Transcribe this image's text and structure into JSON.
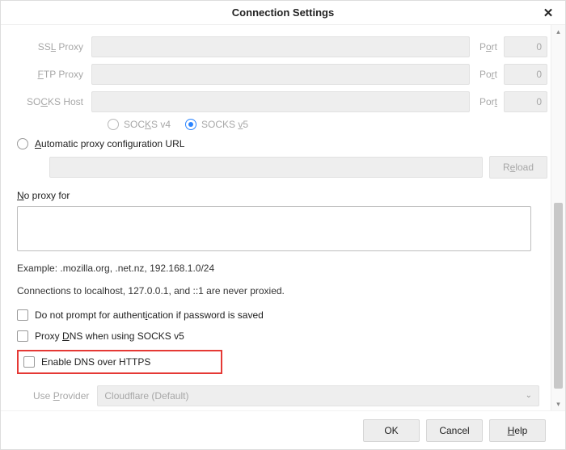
{
  "title": "Connection Settings",
  "proxy": {
    "ssl": {
      "label": "SSL Proxy",
      "port_label": "Port",
      "port": "0"
    },
    "ftp": {
      "label": "FTP Proxy",
      "port_label": "Port",
      "port": "0"
    },
    "socks": {
      "label": "SOCKS Host",
      "port_label": "Port",
      "port": "0"
    }
  },
  "socks_versions": {
    "v4": "SOCKS v4",
    "v5": "SOCKS v5",
    "selected": "v5"
  },
  "auto_url": {
    "label": "Automatic proxy configuration URL",
    "reload": "Reload"
  },
  "no_proxy": {
    "label": "No proxy for",
    "example": "Example: .mozilla.org, .net.nz, 192.168.1.0/24",
    "note": "Connections to localhost, 127.0.0.1, and ::1 are never proxied."
  },
  "checks": {
    "auth": "Do not prompt for authentication if password is saved",
    "dns_socks": "Proxy DNS when using SOCKS v5",
    "dns_https": "Enable DNS over HTTPS"
  },
  "provider": {
    "label": "Use Provider",
    "value": "Cloudflare (Default)"
  },
  "buttons": {
    "ok": "OK",
    "cancel": "Cancel",
    "help": "Help"
  }
}
